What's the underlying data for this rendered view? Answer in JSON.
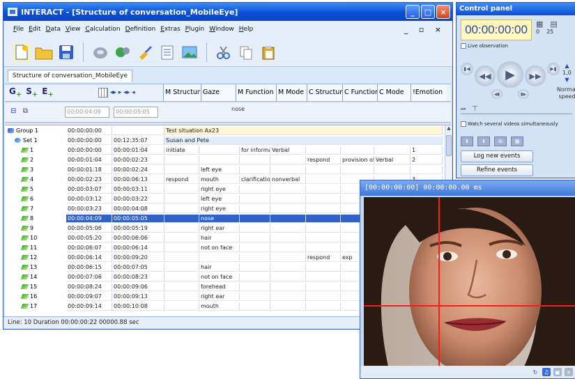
{
  "main_window": {
    "title": "INTERACT - [Structure of conversation_MobileEye]",
    "menu": [
      "File",
      "Edit",
      "Data",
      "View",
      "Calculation",
      "Definition",
      "Extras",
      "Plugin",
      "Window",
      "Help"
    ],
    "mdi_controls": "_ ▫ ×",
    "doc_tab": "Structure of conversation_MobileEye",
    "gse": {
      "g": "G",
      "s": "S",
      "e": "E",
      "plus": "+"
    },
    "columns": [
      "M Structur",
      "Gaze",
      "M Function",
      "M Mode",
      "C Structure",
      "C Function",
      "C Mode",
      "!Emotion"
    ],
    "time_row": {
      "start": "00:00:04:09",
      "end": "00:00:05:05",
      "gaze": "nose"
    },
    "rows": [
      {
        "kind": "group",
        "label": "Group 1",
        "start": "00:00:00:00",
        "end": "",
        "span": "Test situation Ax23"
      },
      {
        "kind": "set",
        "label": "Set 1",
        "start": "00:00:00:00",
        "end": "00:12:35:07",
        "span": "Susan and Pete"
      },
      {
        "kind": "event",
        "label": "1",
        "start": "00:00:00:00",
        "end": "00:00:01:04",
        "cells": [
          "initiate",
          "",
          "for information",
          "Verbal",
          "",
          "",
          "",
          "1"
        ]
      },
      {
        "kind": "event",
        "label": "2",
        "start": "00:00:01:04",
        "end": "00:00:02:23",
        "cells": [
          "",
          "",
          "",
          "",
          "respond",
          "provision of",
          "Verbal",
          "2"
        ]
      },
      {
        "kind": "event",
        "label": "3",
        "start": "00:00:01:18",
        "end": "00:00:02:24",
        "cells": [
          "",
          "left eye",
          "",
          "",
          "",
          "",
          "",
          ""
        ]
      },
      {
        "kind": "event",
        "label": "4",
        "start": "00:00:02:23",
        "end": "00:00:06:13",
        "cells": [
          "respond",
          "mouth",
          "clarification",
          "nonverbal",
          "",
          "",
          "",
          "3"
        ]
      },
      {
        "kind": "event",
        "label": "5",
        "start": "00:00:03:07",
        "end": "00:00:03:11",
        "cells": [
          "",
          "right eye",
          "",
          "",
          "",
          "",
          "",
          ""
        ]
      },
      {
        "kind": "event",
        "label": "6",
        "start": "00:00:03:12",
        "end": "00:00:03:22",
        "cells": [
          "",
          "left eye",
          "",
          "",
          "",
          "",
          "",
          ""
        ]
      },
      {
        "kind": "event",
        "label": "7",
        "start": "00:00:03:23",
        "end": "00:00:04:08",
        "cells": [
          "",
          "right eye",
          "",
          "",
          "",
          "",
          "",
          ""
        ]
      },
      {
        "kind": "event",
        "label": "8",
        "start": "00:00:04:09",
        "end": "00:00:05:05",
        "cells": [
          "",
          "nose",
          "",
          "",
          "",
          "",
          "",
          ""
        ],
        "selected": true
      },
      {
        "kind": "event",
        "label": "9",
        "start": "00:00:05:06",
        "end": "00:00:05:19",
        "cells": [
          "",
          "right ear",
          "",
          "",
          "",
          "",
          "",
          ""
        ]
      },
      {
        "kind": "event",
        "label": "10",
        "start": "00:00:05:20",
        "end": "00:00:06:06",
        "cells": [
          "",
          "hair",
          "",
          "",
          "",
          "",
          "",
          ""
        ]
      },
      {
        "kind": "event",
        "label": "11",
        "start": "00:00:06:07",
        "end": "00:00:06:14",
        "cells": [
          "",
          "not on face",
          "",
          "",
          "",
          "",
          "",
          ""
        ]
      },
      {
        "kind": "event",
        "label": "12",
        "start": "00:00:06:14",
        "end": "00:00:09:20",
        "cells": [
          "",
          "",
          "",
          "",
          "respond",
          "exp",
          "",
          ""
        ]
      },
      {
        "kind": "event",
        "label": "13",
        "start": "00:00:06:15",
        "end": "00:00:07:05",
        "cells": [
          "",
          "hair",
          "",
          "",
          "",
          "",
          "",
          ""
        ]
      },
      {
        "kind": "event",
        "label": "14",
        "start": "00:00:07:06",
        "end": "00:00:08:23",
        "cells": [
          "",
          "not on face",
          "",
          "",
          "",
          "",
          "",
          ""
        ]
      },
      {
        "kind": "event",
        "label": "15",
        "start": "00:00:08:24",
        "end": "00:00:09:06",
        "cells": [
          "",
          "forehead",
          "",
          "",
          "",
          "",
          "",
          ""
        ]
      },
      {
        "kind": "event",
        "label": "16",
        "start": "00:00:09:07",
        "end": "00:00:09:13",
        "cells": [
          "",
          "right ear",
          "",
          "",
          "",
          "",
          "",
          ""
        ]
      },
      {
        "kind": "event",
        "label": "17",
        "start": "00:00:09:14",
        "end": "00:00:10:08",
        "cells": [
          "",
          "mouth",
          "",
          "",
          "",
          "",
          "",
          ""
        ]
      }
    ],
    "status": "Line: 10   Duration 00:00:00:22   00000.88 sec"
  },
  "control_panel": {
    "title": "Control panel",
    "time": "00:00:00:00",
    "vals": [
      "0",
      "25"
    ],
    "live_observation": "Live observation",
    "speed_value": "1,0",
    "speed_label": "Normal speed",
    "watch_several": "Watch several videos simultaneously",
    "log_new_events": "Log new events",
    "refine_events": "Refine events"
  },
  "video_window": {
    "title": "[00:00:00:00]  00:00:00.00 ms"
  },
  "colors": {
    "accent": "#0a4fd8",
    "selection": "#3162c8",
    "crosshair": "#ff1a1a"
  }
}
